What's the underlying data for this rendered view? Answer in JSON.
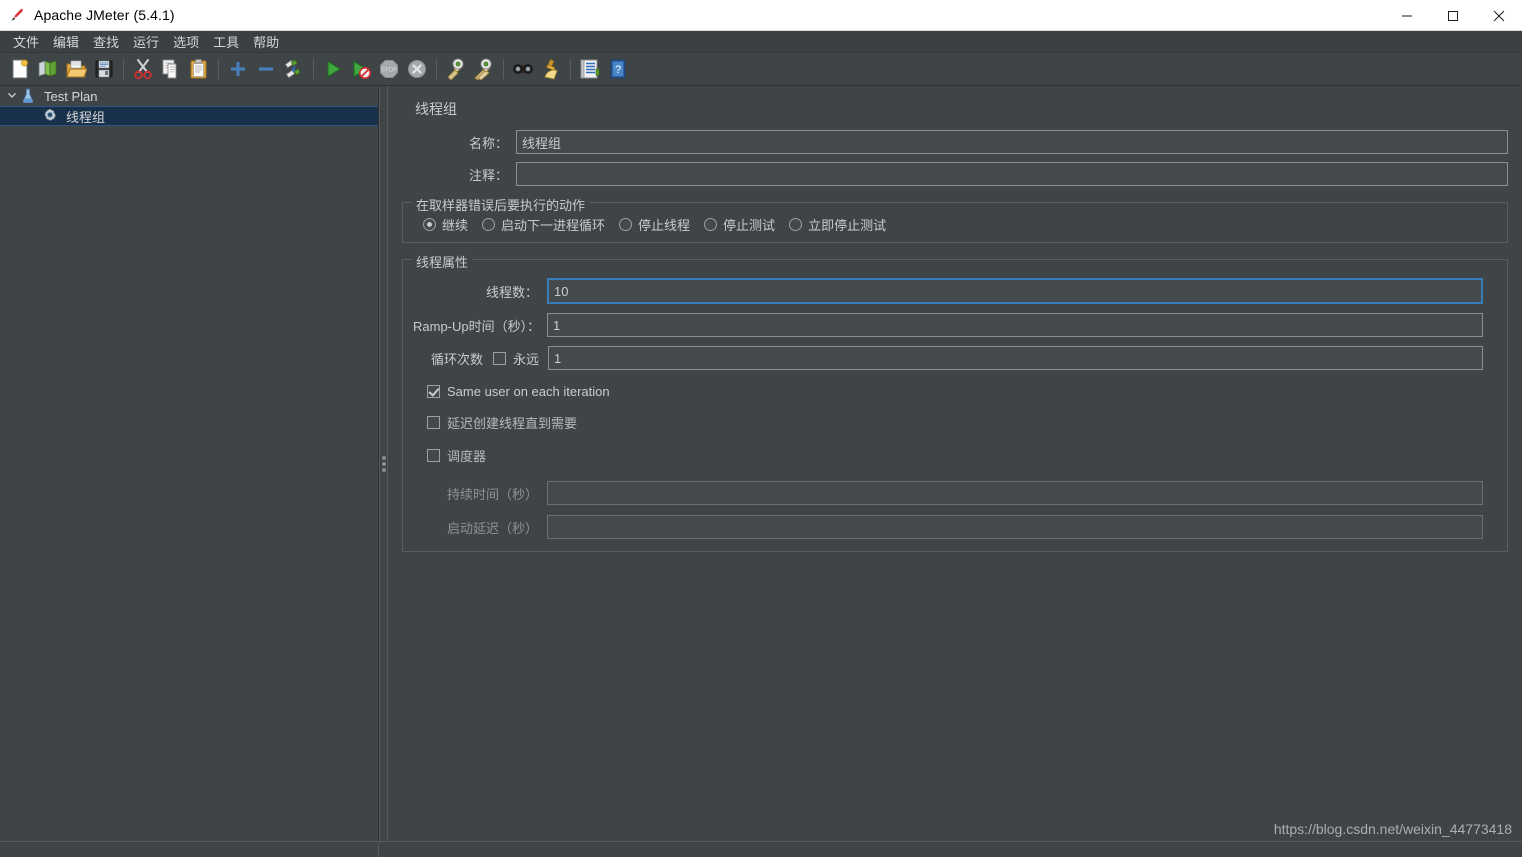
{
  "window": {
    "title": "Apache JMeter (5.4.1)",
    "app_icon": "jmeter-feather-icon",
    "minimize_label": "—",
    "maximize_label": "□",
    "close_label": "✕"
  },
  "menubar": {
    "items": [
      {
        "label": "文件",
        "name": "menu-file"
      },
      {
        "label": "编辑",
        "name": "menu-edit"
      },
      {
        "label": "查找",
        "name": "menu-search"
      },
      {
        "label": "运行",
        "name": "menu-run"
      },
      {
        "label": "选项",
        "name": "menu-options"
      },
      {
        "label": "工具",
        "name": "menu-tools"
      },
      {
        "label": "帮助",
        "name": "menu-help"
      }
    ]
  },
  "toolbar": {
    "buttons": [
      {
        "name": "new-icon",
        "glyph": "new"
      },
      {
        "name": "templates-icon",
        "glyph": "templates"
      },
      {
        "name": "open-icon",
        "glyph": "open"
      },
      {
        "name": "save-icon",
        "glyph": "save"
      },
      {
        "name": "separator",
        "glyph": "sep"
      },
      {
        "name": "cut-icon",
        "glyph": "cut"
      },
      {
        "name": "copy-icon",
        "glyph": "copy"
      },
      {
        "name": "paste-icon",
        "glyph": "paste"
      },
      {
        "name": "separator",
        "glyph": "sep"
      },
      {
        "name": "expand-all-icon",
        "glyph": "plus"
      },
      {
        "name": "collapse-all-icon",
        "glyph": "minus"
      },
      {
        "name": "toggle-icon",
        "glyph": "toggle"
      },
      {
        "name": "separator",
        "glyph": "sep"
      },
      {
        "name": "start-icon",
        "glyph": "start"
      },
      {
        "name": "start-no-timers-icon",
        "glyph": "start-no-pauses"
      },
      {
        "name": "stop-icon",
        "glyph": "stop"
      },
      {
        "name": "shutdown-icon",
        "glyph": "shutdown"
      },
      {
        "name": "separator",
        "glyph": "sep"
      },
      {
        "name": "clear-icon",
        "glyph": "clear"
      },
      {
        "name": "clear-all-icon",
        "glyph": "clear-all"
      },
      {
        "name": "separator",
        "glyph": "sep"
      },
      {
        "name": "search-icon",
        "glyph": "binoculars"
      },
      {
        "name": "reset-search-icon",
        "glyph": "broom"
      },
      {
        "name": "separator",
        "glyph": "sep"
      },
      {
        "name": "function-helper-icon",
        "glyph": "function-helper"
      },
      {
        "name": "help-icon",
        "glyph": "help"
      }
    ]
  },
  "tree": {
    "nodes": [
      {
        "label": "Test Plan",
        "icon": "test-plan-icon",
        "selected": false,
        "depth": 0,
        "expanded": true
      },
      {
        "label": "线程组",
        "icon": "thread-group-gear-icon",
        "selected": true,
        "depth": 1,
        "expanded": false
      }
    ]
  },
  "panel": {
    "title": "线程组",
    "name_label": "名称：",
    "name_value": "线程组",
    "comment_label": "注释：",
    "comment_value": "",
    "error_action": {
      "group_title": "在取样器错误后要执行的动作",
      "options": [
        {
          "label": "继续",
          "selected": true,
          "name": "radio-continue"
        },
        {
          "label": "启动下一进程循环",
          "selected": false,
          "name": "radio-start-next-loop"
        },
        {
          "label": "停止线程",
          "selected": false,
          "name": "radio-stop-thread"
        },
        {
          "label": "停止测试",
          "selected": false,
          "name": "radio-stop-test"
        },
        {
          "label": "立即停止测试",
          "selected": false,
          "name": "radio-stop-test-now"
        }
      ]
    },
    "thread_properties": {
      "group_title": "线程属性",
      "num_threads_label": "线程数：",
      "num_threads_value": "10",
      "ramp_up_label": "Ramp-Up时间（秒）：",
      "ramp_up_value": "1",
      "loop_count_label": "循环次数",
      "forever_label": "永远",
      "forever_checked": false,
      "loop_count_value": "1",
      "same_user_label": "Same user on each iteration",
      "same_user_checked": true,
      "delay_thread_creation_label": "延迟创建线程直到需要",
      "delay_thread_creation_checked": false,
      "scheduler_label": "调度器",
      "scheduler_checked": false,
      "duration_label": "持续时间（秒）",
      "duration_value": "",
      "startup_delay_label": "启动延迟（秒）",
      "startup_delay_value": ""
    }
  },
  "watermark": "https://blog.csdn.net/weixin_44773418",
  "colors": {
    "background": "#3f4447",
    "field_background": "#44494c",
    "text": "#c8ccce",
    "focus_border": "#3a7cb8",
    "tree_selection": "#183049",
    "titlebar_background": "#ffffff"
  }
}
